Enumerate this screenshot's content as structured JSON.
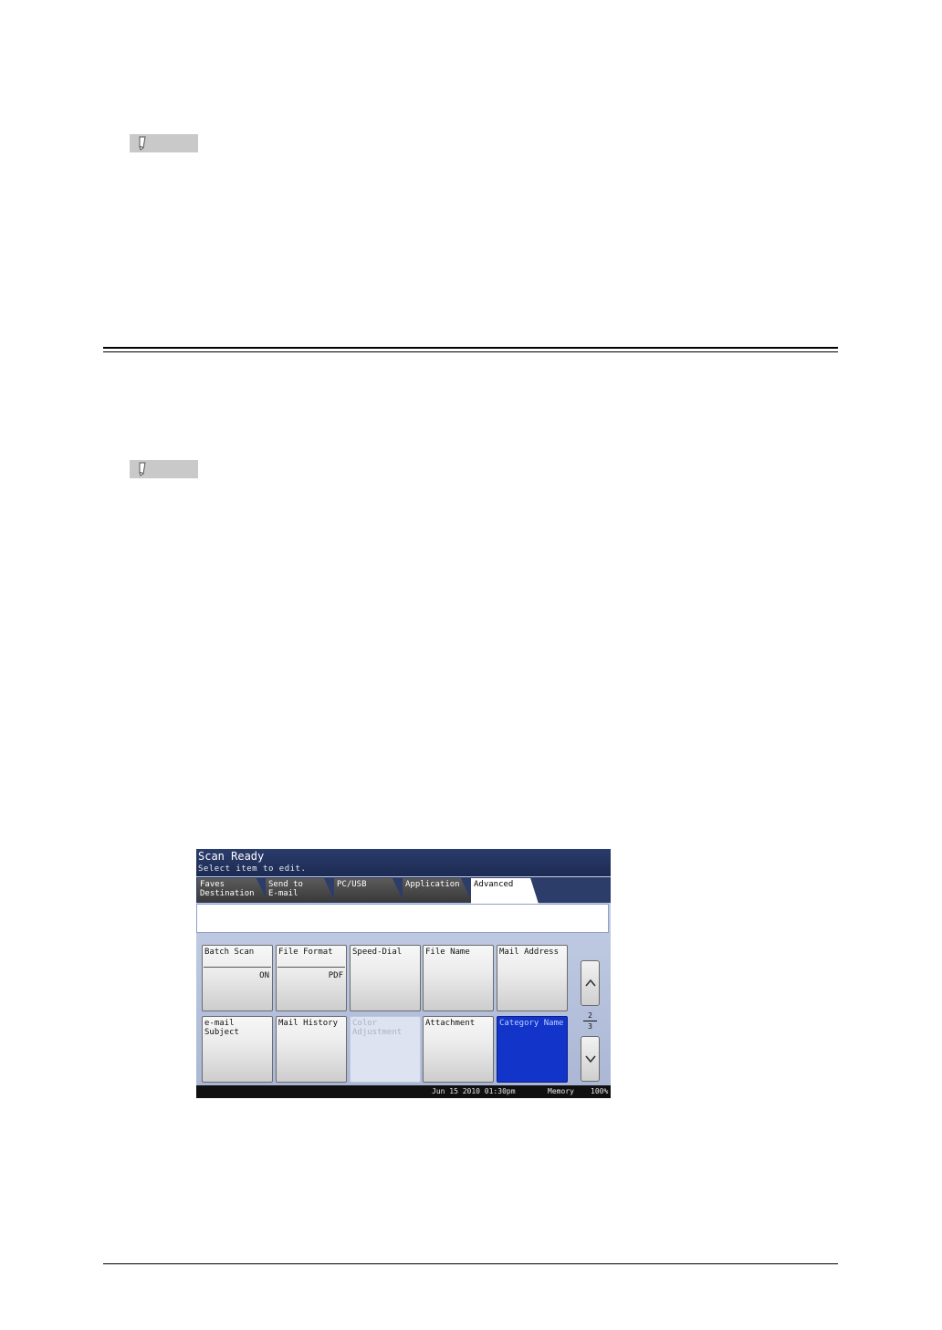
{
  "panel": {
    "title": "Scan Ready",
    "subtitle": "Select item to edit.",
    "tabs": [
      {
        "label": "Faves\nDestination"
      },
      {
        "label": "Send to\nE-mail"
      },
      {
        "label": "PC/USB"
      },
      {
        "label": "Application"
      },
      {
        "label": "Advanced"
      }
    ],
    "buttons": [
      {
        "label": "Batch Scan",
        "value": "ON"
      },
      {
        "label": "File Format",
        "value": "PDF"
      },
      {
        "label": "Speed-Dial"
      },
      {
        "label": "File Name"
      },
      {
        "label": "Mail Address"
      },
      {
        "label": "e-mail Subject"
      },
      {
        "label": "Mail History"
      },
      {
        "label": "Color\nAdjustment"
      },
      {
        "label": "Attachment"
      },
      {
        "label": "Category Name"
      }
    ],
    "page": {
      "current": "2",
      "total": "3"
    },
    "status": {
      "datetime": "Jun 15 2010 01:30pm",
      "memory_label": "Memory",
      "memory_value": "100%"
    }
  }
}
